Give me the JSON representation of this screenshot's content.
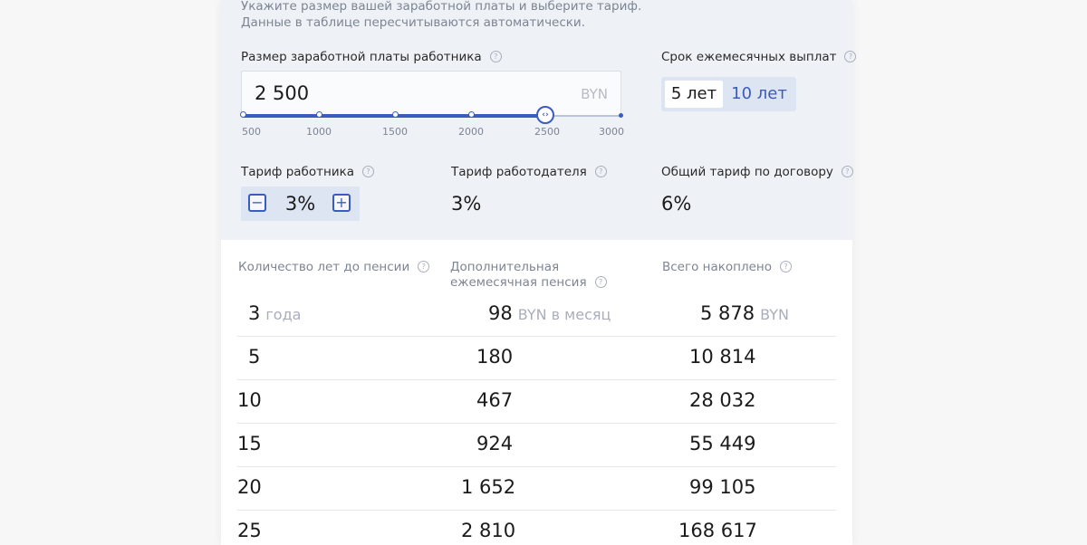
{
  "intro": {
    "line1": "Укажите размер вашей заработной платы и выберите тариф.",
    "line2": "Данные в таблице пересчитываются автоматически."
  },
  "salary": {
    "label": "Размер заработной платы работника",
    "value": "2 500",
    "unit": "BYN",
    "slider_ticks": [
      "500",
      "1000",
      "1500",
      "2000",
      "2500",
      "3000"
    ],
    "slider_value": 2500
  },
  "term": {
    "label": "Срок ежемесячных выплат",
    "options": [
      "5 лет",
      "10 лет"
    ],
    "selected": "5 лет"
  },
  "employee_rate": {
    "label": "Тариф работника",
    "value": "3%"
  },
  "employer_rate": {
    "label": "Тариф работодателя",
    "value": "3%"
  },
  "total_rate": {
    "label": "Общий тариф по договору",
    "value": "6%"
  },
  "table": {
    "headers": [
      "Количество лет до пенсии",
      "Дополнительная ежемесячная пенсия",
      "Всего накоплено"
    ],
    "first_row_units": {
      "years": "года",
      "pension": "BYN в месяц",
      "total": "BYN"
    },
    "rows": [
      {
        "years": "3",
        "pension": "98",
        "total": "5 878"
      },
      {
        "years": "5",
        "pension": "180",
        "total": "10 814"
      },
      {
        "years": "10",
        "pension": "467",
        "total": "28 032"
      },
      {
        "years": "15",
        "pension": "924",
        "total": "55 449"
      },
      {
        "years": "20",
        "pension": "1 652",
        "total": "99 105"
      },
      {
        "years": "25",
        "pension": "2 810",
        "total": "168 617"
      }
    ]
  },
  "help_glyph": "?",
  "colors": {
    "accent": "#3a5cc1",
    "panel": "#eef1f6",
    "muted": "#7d8593"
  }
}
